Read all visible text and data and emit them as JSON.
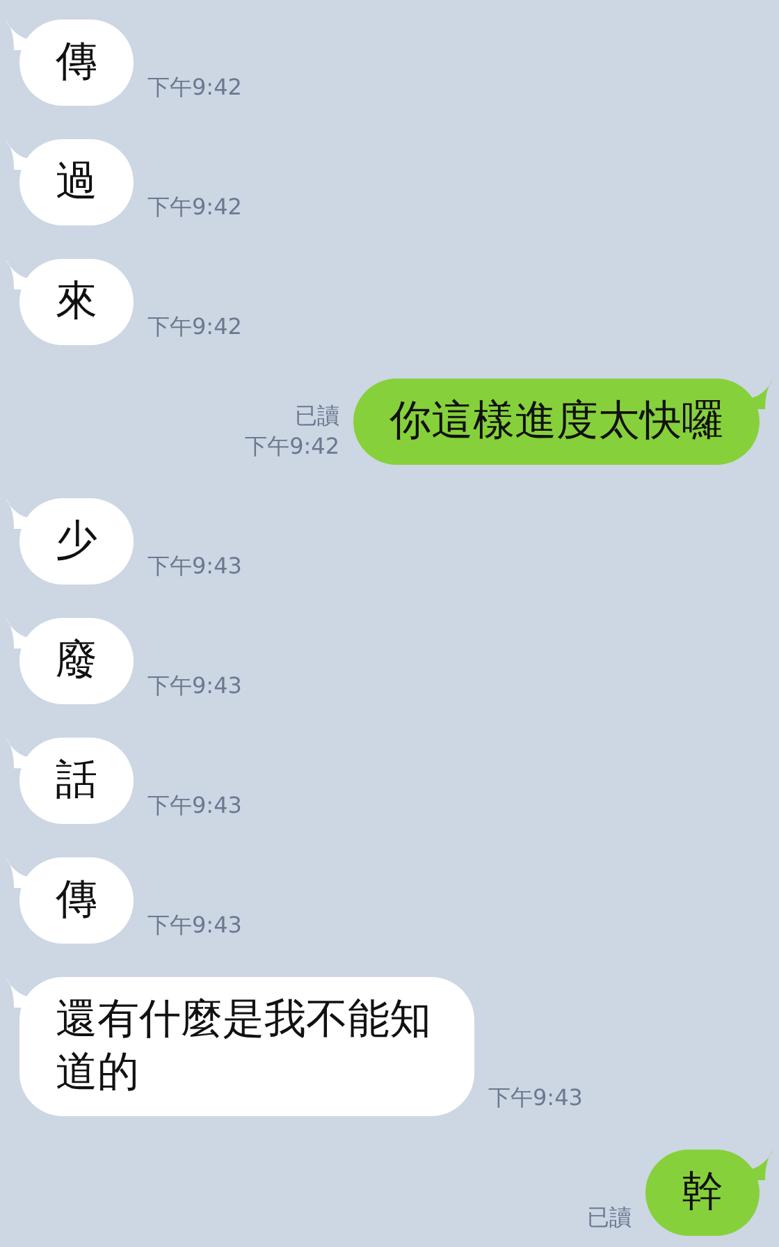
{
  "messages": [
    {
      "kind": "incoming",
      "text": "傳",
      "time": "下午9:42"
    },
    {
      "kind": "incoming",
      "text": "過",
      "time": "下午9:42"
    },
    {
      "kind": "incoming",
      "text": "來",
      "time": "下午9:42"
    },
    {
      "kind": "outgoing",
      "text": "你這樣進度太快囉",
      "read_label": "已讀",
      "time": "下午9:42"
    },
    {
      "kind": "incoming",
      "text": "少",
      "time": "下午9:43"
    },
    {
      "kind": "incoming",
      "text": "廢",
      "time": "下午9:43"
    },
    {
      "kind": "incoming",
      "text": "話",
      "time": "下午9:43"
    },
    {
      "kind": "incoming",
      "text": "傳",
      "time": "下午9:43"
    },
    {
      "kind": "incoming",
      "text": "還有什麼是我不能知道的",
      "time": "下午9:43"
    },
    {
      "kind": "outgoing",
      "text": "幹",
      "read_label": "已讀"
    }
  ]
}
